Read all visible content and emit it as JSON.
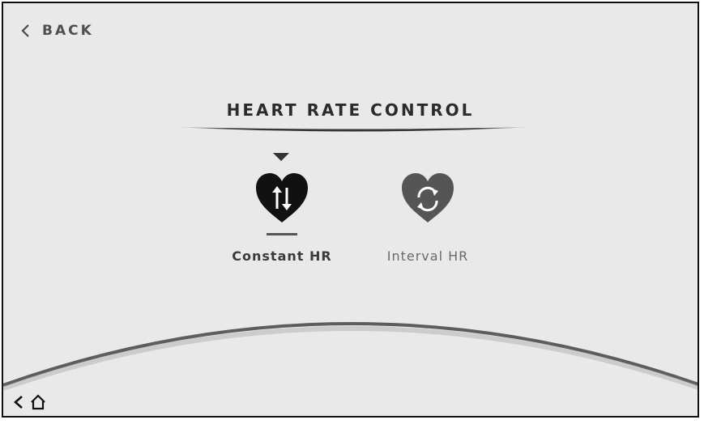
{
  "header": {
    "back_label": "BACK"
  },
  "main": {
    "title": "HEART RATE CONTROL",
    "options": [
      {
        "label": "Constant HR",
        "icon": "heart-arrows-icon",
        "selected": true
      },
      {
        "label": "Interval HR",
        "icon": "heart-cycle-icon",
        "selected": false
      }
    ]
  },
  "nav": {
    "back_icon": "chevron-left-icon",
    "home_icon": "home-icon"
  },
  "colors": {
    "background": "#e9e9e9",
    "selected_heart": "#111111",
    "unselected_heart": "#555555"
  }
}
